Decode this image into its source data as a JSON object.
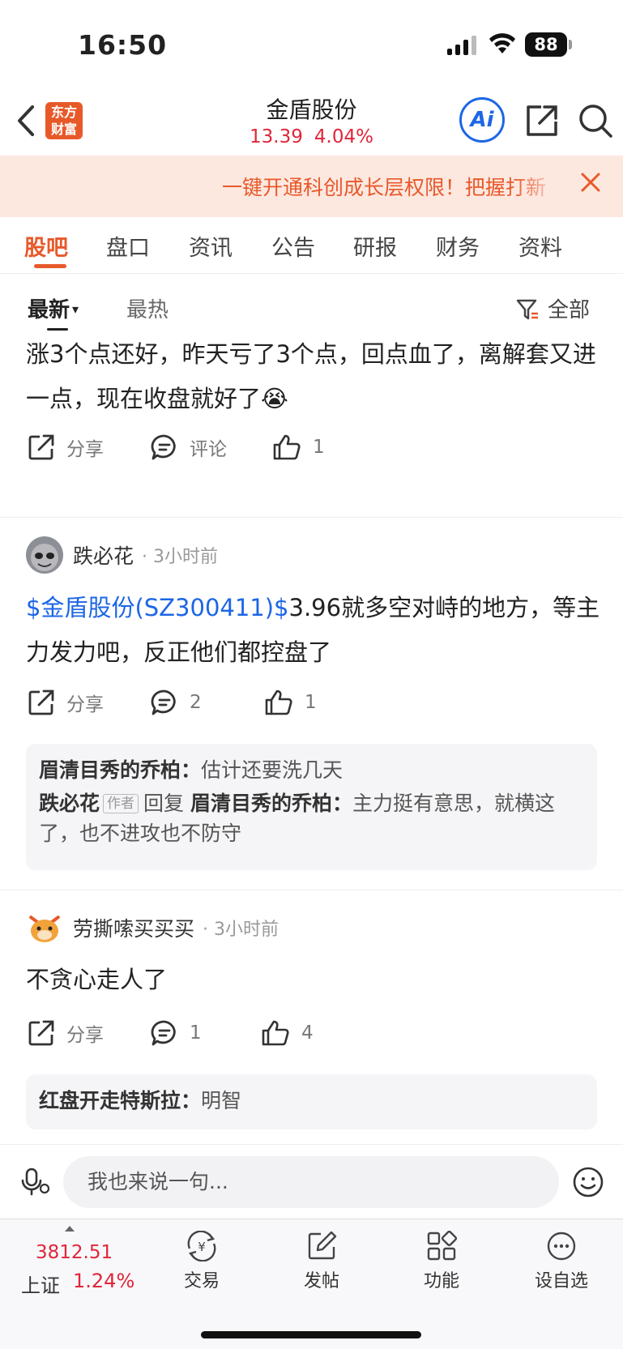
{
  "status_bar": {
    "time": "16:50",
    "battery": "88"
  },
  "header": {
    "logo": "东方财富",
    "title": "金盾股份",
    "price": "13.39",
    "change_pct": "4.04%",
    "ai_label": "Ai",
    "icons": [
      "back-icon",
      "share-icon",
      "search-icon"
    ]
  },
  "banner": {
    "text": "一键开通科创成长层权限！把握打新",
    "close_icon": "close-icon"
  },
  "tabs": [
    {
      "label": "股吧",
      "active": true
    },
    {
      "label": "盘口"
    },
    {
      "label": "资讯"
    },
    {
      "label": "公告"
    },
    {
      "label": "研报"
    },
    {
      "label": "财务"
    },
    {
      "label": "资料"
    }
  ],
  "sort": {
    "latest": "最新",
    "hot": "最热",
    "filter": "全部"
  },
  "posts": [
    {
      "text": "涨3个点还好，昨天亏了3个点，回点血了，离解套又进一点，现在收盘就好了😭",
      "share": "分享",
      "comment": "评论",
      "likes": "1"
    },
    {
      "author": "跌必花",
      "time": "· 3小时前",
      "link": "$金盾股份(SZ300411)$",
      "text": "3.96就多空对峙的地方，等主力发力吧，反正他们都控盘了",
      "share": "分享",
      "comments": "2",
      "likes": "1",
      "replies": [
        {
          "user": "眉清目秀的乔柏：",
          "text": "估计还要洗几天"
        },
        {
          "user": "跌必花",
          "tag": "作者",
          "verb": "回复",
          "target": "眉清目秀的乔柏：",
          "text": "主力挺有意思，就横这了，也不进攻也不防守"
        }
      ]
    },
    {
      "author": "劳撕嗦买买买",
      "time": "· 3小时前",
      "text": "不贪心走人了",
      "share": "分享",
      "comments": "1",
      "likes": "4",
      "replies": [
        {
          "user": "红盘开走特斯拉：",
          "text": "明智"
        }
      ]
    }
  ],
  "comment_bar": {
    "placeholder": "我也来说一句..."
  },
  "bottom_nav": {
    "index_value": "3812.51",
    "index_name": "上证",
    "index_pct": "1.24%",
    "items": [
      "交易",
      "发帖",
      "功能",
      "设自选"
    ]
  },
  "colors": {
    "accent": "#e8592a",
    "up_red": "#e0263a",
    "link_blue": "#1d66e6"
  }
}
